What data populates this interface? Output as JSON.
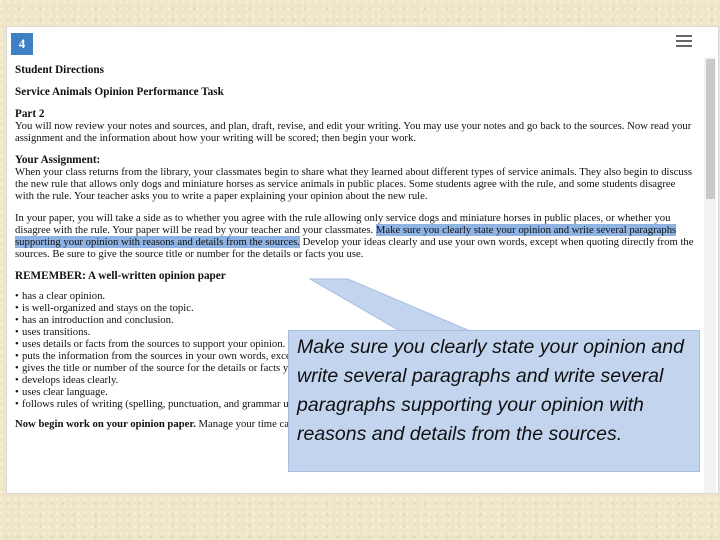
{
  "question_number": "4",
  "menu_icon": "hamburger-menu-icon",
  "directions_title": "Student Directions",
  "task_title": "Service Animals Opinion Performance Task",
  "part_title": "Part 2",
  "part_text": "You will now review your notes and sources, and plan, draft, revise, and edit your writing. You may use your notes and go back to the sources. Now read your assignment and the information about how your writing will be scored; then begin your work.",
  "assignment_title": "Your Assignment:",
  "assignment_text": "When your class returns from the library, your classmates begin to share what they learned about different types of service animals. They also begin to discuss the new rule that allows only dogs and miniature horses as service animals in public places. Some students agree with the rule, and some students disagree with the rule. Your teacher asks you to write a paper explaining your opinion about the new rule.",
  "paper_text_before": "In your paper, you will take a side as to whether you agree with the rule allowing only service dogs and miniature horses in public places, or whether you disagree with the rule. Your paper will be read by your teacher and your classmates. ",
  "paper_text_highlight": "Make sure you clearly state your opinion and write several paragraphs supporting your opinion with reasons and details from the sources.",
  "paper_text_after": " Develop your ideas clearly and use your own words, except when quoting directly from the sources. Be sure to give the source title or number for the details or facts you use.",
  "remember_title": "REMEMBER: A well-written opinion paper",
  "remember_items": [
    "has a clear opinion.",
    "is well-organized and stays on the topic.",
    "has an introduction and conclusion.",
    "uses transitions.",
    "uses details or facts from the sources to support your opinion.",
    "puts the information from the sources in your own words, except when using direct quotations from the sources.",
    "gives the title or number of the source for the details or facts you included.",
    "develops ideas clearly.",
    "uses clear language.",
    "follows rules of writing (spelling, punctuation, and grammar usage)."
  ],
  "begin_bold": "Now begin work on your opinion paper.",
  "begin_rest": " Manage your time carefully so that you can",
  "callout_text": "Make sure you clearly state your opinion and write several paragraphs and write several paragraphs supporting your opinion with reasons and details from the sources.",
  "colors": {
    "background": "#efe6c8",
    "question_badge": "#3f7fc4",
    "highlight": "#8fb4e3",
    "callout_fill": "#c2d4ee"
  }
}
